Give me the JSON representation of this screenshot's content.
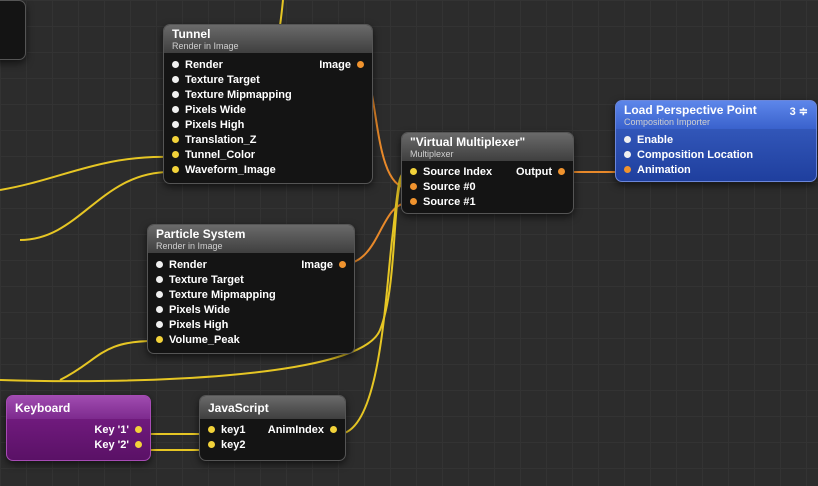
{
  "colors": {
    "wire_yellow": "#e6c624",
    "wire_orange": "#e8892a",
    "port_white": "#f0f0f0",
    "port_yellow": "#f2d23a",
    "port_orange": "#f0932e"
  },
  "tunnel": {
    "title": "Tunnel",
    "subtitle": "Render in Image",
    "inputs": [
      "Render",
      "Texture Target",
      "Texture Mipmapping",
      "Pixels Wide",
      "Pixels High",
      "Translation_Z",
      "Tunnel_Color",
      "Waveform_Image"
    ],
    "output": "Image"
  },
  "particle": {
    "title": "Particle System",
    "subtitle": "Render in Image",
    "inputs": [
      "Render",
      "Texture Target",
      "Texture Mipmapping",
      "Pixels Wide",
      "Pixels High",
      "Volume_Peak"
    ],
    "output": "Image"
  },
  "multiplexer": {
    "title": "\"Virtual Multiplexer\"",
    "subtitle": "Multiplexer",
    "inputs": [
      "Source Index",
      "Source #0",
      "Source #1"
    ],
    "output": "Output"
  },
  "loadpoint": {
    "title": "Load Perspective Point",
    "subtitle": "Composition Importer",
    "badge": "3 ≑",
    "inputs": [
      "Enable",
      "Composition Location",
      "Animation"
    ]
  },
  "keyboard": {
    "title": "Keyboard",
    "outputs": [
      "Key '1'",
      "Key '2'"
    ]
  },
  "javascript": {
    "title": "JavaScript",
    "inputs": [
      "key1",
      "key2"
    ],
    "output": "AnimIndex"
  }
}
